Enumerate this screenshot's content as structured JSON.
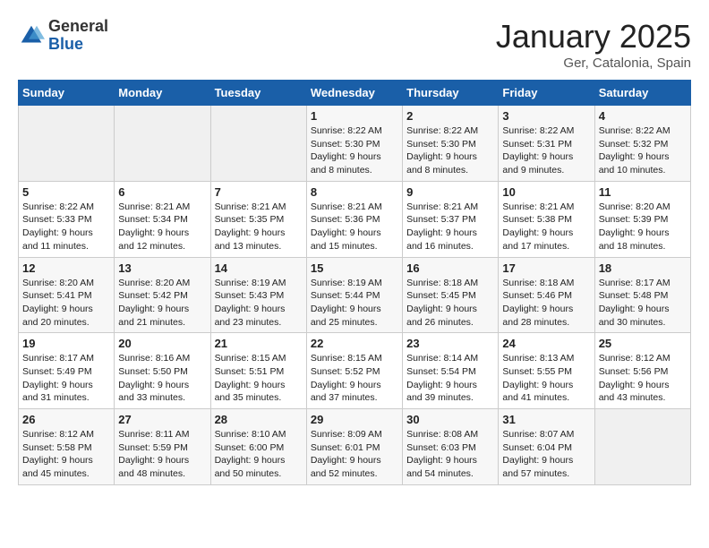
{
  "logo": {
    "general": "General",
    "blue": "Blue"
  },
  "title": "January 2025",
  "location": "Ger, Catalonia, Spain",
  "weekdays": [
    "Sunday",
    "Monday",
    "Tuesday",
    "Wednesday",
    "Thursday",
    "Friday",
    "Saturday"
  ],
  "weeks": [
    [
      {
        "day": "",
        "info": ""
      },
      {
        "day": "",
        "info": ""
      },
      {
        "day": "",
        "info": ""
      },
      {
        "day": "1",
        "info": "Sunrise: 8:22 AM\nSunset: 5:30 PM\nDaylight: 9 hours\nand 8 minutes."
      },
      {
        "day": "2",
        "info": "Sunrise: 8:22 AM\nSunset: 5:30 PM\nDaylight: 9 hours\nand 8 minutes."
      },
      {
        "day": "3",
        "info": "Sunrise: 8:22 AM\nSunset: 5:31 PM\nDaylight: 9 hours\nand 9 minutes."
      },
      {
        "day": "4",
        "info": "Sunrise: 8:22 AM\nSunset: 5:32 PM\nDaylight: 9 hours\nand 10 minutes."
      }
    ],
    [
      {
        "day": "5",
        "info": "Sunrise: 8:22 AM\nSunset: 5:33 PM\nDaylight: 9 hours\nand 11 minutes."
      },
      {
        "day": "6",
        "info": "Sunrise: 8:21 AM\nSunset: 5:34 PM\nDaylight: 9 hours\nand 12 minutes."
      },
      {
        "day": "7",
        "info": "Sunrise: 8:21 AM\nSunset: 5:35 PM\nDaylight: 9 hours\nand 13 minutes."
      },
      {
        "day": "8",
        "info": "Sunrise: 8:21 AM\nSunset: 5:36 PM\nDaylight: 9 hours\nand 15 minutes."
      },
      {
        "day": "9",
        "info": "Sunrise: 8:21 AM\nSunset: 5:37 PM\nDaylight: 9 hours\nand 16 minutes."
      },
      {
        "day": "10",
        "info": "Sunrise: 8:21 AM\nSunset: 5:38 PM\nDaylight: 9 hours\nand 17 minutes."
      },
      {
        "day": "11",
        "info": "Sunrise: 8:20 AM\nSunset: 5:39 PM\nDaylight: 9 hours\nand 18 minutes."
      }
    ],
    [
      {
        "day": "12",
        "info": "Sunrise: 8:20 AM\nSunset: 5:41 PM\nDaylight: 9 hours\nand 20 minutes."
      },
      {
        "day": "13",
        "info": "Sunrise: 8:20 AM\nSunset: 5:42 PM\nDaylight: 9 hours\nand 21 minutes."
      },
      {
        "day": "14",
        "info": "Sunrise: 8:19 AM\nSunset: 5:43 PM\nDaylight: 9 hours\nand 23 minutes."
      },
      {
        "day": "15",
        "info": "Sunrise: 8:19 AM\nSunset: 5:44 PM\nDaylight: 9 hours\nand 25 minutes."
      },
      {
        "day": "16",
        "info": "Sunrise: 8:18 AM\nSunset: 5:45 PM\nDaylight: 9 hours\nand 26 minutes."
      },
      {
        "day": "17",
        "info": "Sunrise: 8:18 AM\nSunset: 5:46 PM\nDaylight: 9 hours\nand 28 minutes."
      },
      {
        "day": "18",
        "info": "Sunrise: 8:17 AM\nSunset: 5:48 PM\nDaylight: 9 hours\nand 30 minutes."
      }
    ],
    [
      {
        "day": "19",
        "info": "Sunrise: 8:17 AM\nSunset: 5:49 PM\nDaylight: 9 hours\nand 31 minutes."
      },
      {
        "day": "20",
        "info": "Sunrise: 8:16 AM\nSunset: 5:50 PM\nDaylight: 9 hours\nand 33 minutes."
      },
      {
        "day": "21",
        "info": "Sunrise: 8:15 AM\nSunset: 5:51 PM\nDaylight: 9 hours\nand 35 minutes."
      },
      {
        "day": "22",
        "info": "Sunrise: 8:15 AM\nSunset: 5:52 PM\nDaylight: 9 hours\nand 37 minutes."
      },
      {
        "day": "23",
        "info": "Sunrise: 8:14 AM\nSunset: 5:54 PM\nDaylight: 9 hours\nand 39 minutes."
      },
      {
        "day": "24",
        "info": "Sunrise: 8:13 AM\nSunset: 5:55 PM\nDaylight: 9 hours\nand 41 minutes."
      },
      {
        "day": "25",
        "info": "Sunrise: 8:12 AM\nSunset: 5:56 PM\nDaylight: 9 hours\nand 43 minutes."
      }
    ],
    [
      {
        "day": "26",
        "info": "Sunrise: 8:12 AM\nSunset: 5:58 PM\nDaylight: 9 hours\nand 45 minutes."
      },
      {
        "day": "27",
        "info": "Sunrise: 8:11 AM\nSunset: 5:59 PM\nDaylight: 9 hours\nand 48 minutes."
      },
      {
        "day": "28",
        "info": "Sunrise: 8:10 AM\nSunset: 6:00 PM\nDaylight: 9 hours\nand 50 minutes."
      },
      {
        "day": "29",
        "info": "Sunrise: 8:09 AM\nSunset: 6:01 PM\nDaylight: 9 hours\nand 52 minutes."
      },
      {
        "day": "30",
        "info": "Sunrise: 8:08 AM\nSunset: 6:03 PM\nDaylight: 9 hours\nand 54 minutes."
      },
      {
        "day": "31",
        "info": "Sunrise: 8:07 AM\nSunset: 6:04 PM\nDaylight: 9 hours\nand 57 minutes."
      },
      {
        "day": "",
        "info": ""
      }
    ]
  ]
}
